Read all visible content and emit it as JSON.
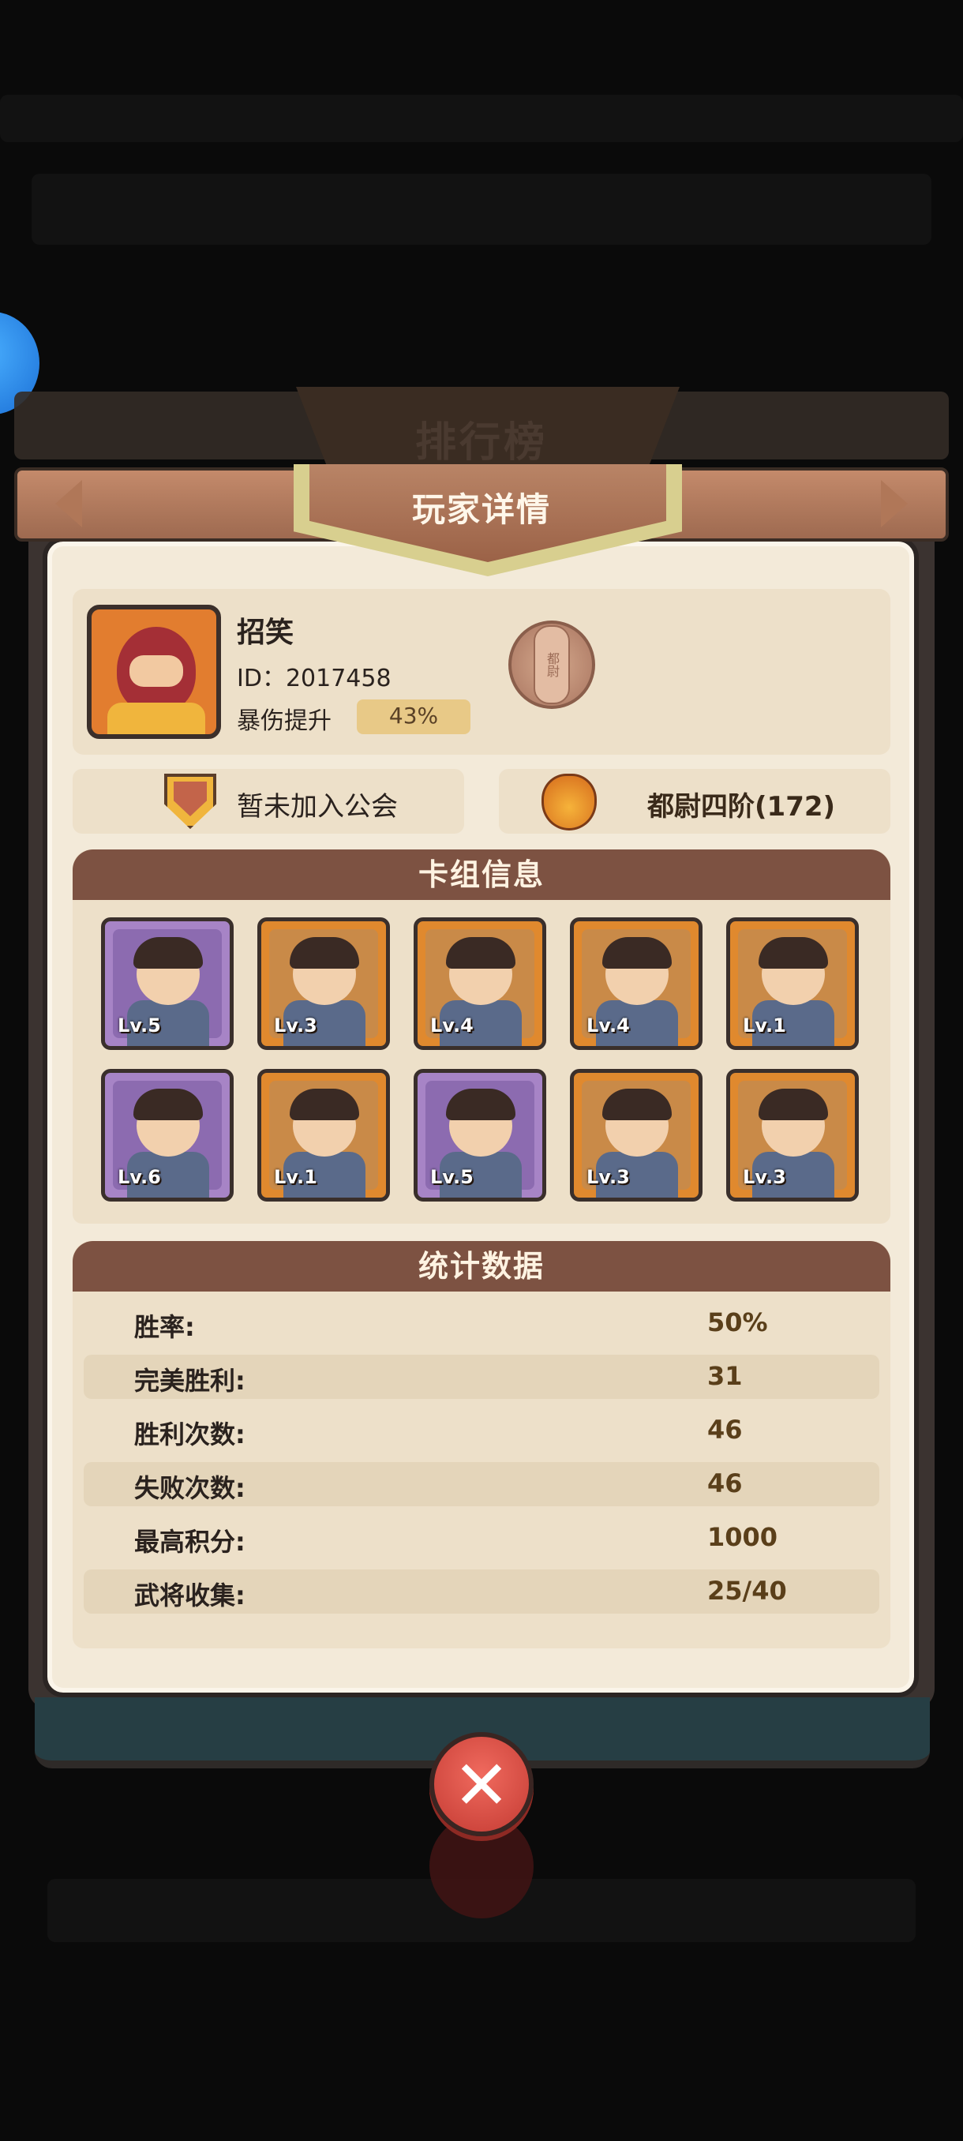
{
  "background_title": "排行榜",
  "panel_title": "玩家详情",
  "player": {
    "name": "招笑",
    "id": "ID：2017458",
    "crit_label": "暴伤提升",
    "crit_value": "43%",
    "rank_badge_text": "都尉",
    "guild": "暂未加入公会",
    "rank": "都尉四阶(172)"
  },
  "deck": {
    "title": "卡组信息",
    "cards": [
      {
        "level": "Lv.5",
        "frame": "purple"
      },
      {
        "level": "Lv.3",
        "frame": "orange"
      },
      {
        "level": "Lv.4",
        "frame": "orange"
      },
      {
        "level": "Lv.4",
        "frame": "orange"
      },
      {
        "level": "Lv.1",
        "frame": "orange"
      },
      {
        "level": "Lv.6",
        "frame": "purple"
      },
      {
        "level": "Lv.1",
        "frame": "orange"
      },
      {
        "level": "Lv.5",
        "frame": "purple"
      },
      {
        "level": "Lv.3",
        "frame": "orange"
      },
      {
        "level": "Lv.3",
        "frame": "orange"
      }
    ]
  },
  "stats": {
    "title": "统计数据",
    "rows": [
      {
        "label": "胜率:",
        "value": "50%"
      },
      {
        "label": "完美胜利:",
        "value": "31"
      },
      {
        "label": "胜利次数:",
        "value": "46"
      },
      {
        "label": "失败次数:",
        "value": "46"
      },
      {
        "label": "最高积分:",
        "value": "1000"
      },
      {
        "label": "武将收集:",
        "value": "25/40"
      }
    ]
  },
  "colors": {
    "panel_bg": "#f3ead9",
    "section_header": "#7d5242",
    "value_text": "#5a3f1a",
    "close_button": "#d94a40"
  }
}
